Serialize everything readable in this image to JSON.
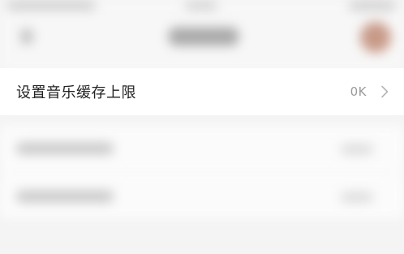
{
  "setting_row": {
    "label": "设置音乐缓存上限",
    "value": "0K",
    "chevron_icon": "chevron-right-icon"
  },
  "colors": {
    "background": "#f4f4f4",
    "row_background": "#ffffff",
    "label_text": "#222222",
    "value_text": "#9a9a9a"
  }
}
